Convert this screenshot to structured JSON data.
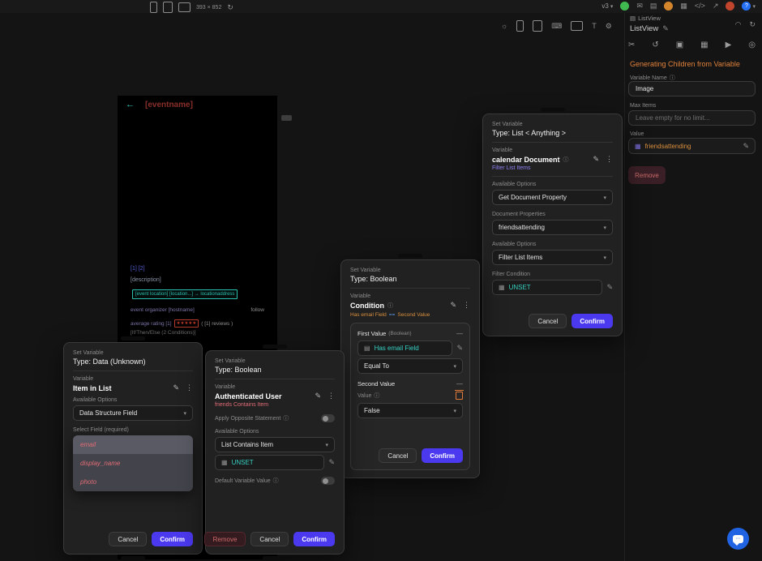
{
  "icons": {
    "edit": "✎",
    "kebab": "⋮",
    "info": "ⓘ",
    "chevron_down": "▾",
    "minus": "—",
    "back_arrow": "←",
    "rotate": "↻",
    "theme": "☼",
    "keyboard": "⌨",
    "text_scale": "T",
    "settings": "⚙",
    "wifi": "◠",
    "cut": "✂",
    "undo": "↺",
    "copy": "▣",
    "table": "▦",
    "play": "▶",
    "target": "◎",
    "tree": "▤",
    "message": "✉",
    "apps": "▦",
    "code": "</>",
    "share": "↗",
    "help": "?",
    "dots": "⋯"
  },
  "topbar": {
    "device_size": "393 × 852",
    "version_label": "v3"
  },
  "right_panel": {
    "tree_label": "ListView",
    "widget_name": "ListView",
    "section_title": "Generating Children from Variable",
    "variable_name_label": "Variable Name",
    "variable_name_value": "Image",
    "max_items_label": "Max Items",
    "max_items_placeholder": "Leave empty for no limit...",
    "value_label": "Value",
    "value_text": "friendsattending",
    "remove_label": "Remove"
  },
  "phone": {
    "title": "[eventname]",
    "pages": "[1] [2]",
    "description": "[description]",
    "location": "[event location]  [location...]  →  locationaddress",
    "organizer": "event organizer  [hostname]",
    "follow": "follow",
    "rating": "average rating  [1]",
    "stars": "★★★★★",
    "reviews": "( [1] reviews )",
    "conditional": "[If/Then/Else (2 Conditions)]"
  },
  "dialog_list": {
    "header": "Set Variable",
    "type": "Type: List < Anything >",
    "variable_label": "Variable",
    "variable_name": "calendar Document",
    "link": "Filter List Items",
    "available_options_label": "Available Options",
    "option_get_doc": "Get Document Property",
    "doc_props_label": "Document Properties",
    "doc_prop_value": "friendsattending",
    "option_filter": "Filter List Items",
    "filter_condition_label": "Filter Condition",
    "unset": "UNSET",
    "cancel": "Cancel",
    "confirm": "Confirm"
  },
  "dialog_condition": {
    "header": "Set Variable",
    "type": "Type: Boolean",
    "variable_label": "Variable",
    "variable_name": "Condition",
    "summary_left": "Has email Field",
    "summary_op": "==",
    "summary_right": "Second Value",
    "first_value_label": "First Value",
    "first_value_type": "(Boolean)",
    "first_value_chip": "Has email Field",
    "operator": "Equal To",
    "second_value_label": "Second Value",
    "value_label": "Value",
    "value": "False",
    "cancel": "Cancel",
    "confirm": "Confirm"
  },
  "dialog_item": {
    "header": "Set Variable",
    "type": "Type: Data (Unknown)",
    "variable_label": "Variable",
    "variable_name": "Item in List",
    "available_options_label": "Available Options",
    "option": "Data Structure Field",
    "select_field_label": "Select Field (required)",
    "options": [
      "email",
      "display_name",
      "photo"
    ],
    "cancel": "Cancel",
    "confirm": "Confirm"
  },
  "dialog_auth": {
    "header": "Set Variable",
    "type": "Type: Boolean",
    "variable_label": "Variable",
    "variable_name": "Authenticated User",
    "subtitle": "friends Contains Item",
    "opposite_label": "Apply Opposite Statement",
    "available_options_label": "Available Options",
    "option": "List Contains Item",
    "unset": "UNSET",
    "default_label": "Default Variable Value",
    "remove": "Remove",
    "cancel": "Cancel",
    "confirm": "Confirm"
  }
}
